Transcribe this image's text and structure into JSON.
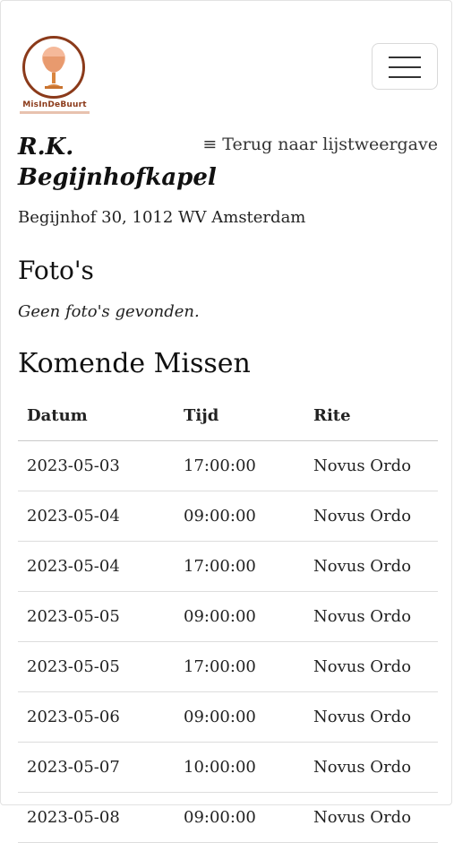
{
  "brand": {
    "logo_text": "MisInDeBuurt",
    "logo_icon": "chalice-icon",
    "accent_color": "#8b3a1a"
  },
  "nav": {
    "menu_icon": "hamburger-icon"
  },
  "church": {
    "name": "R.K. Begijnhofkapel",
    "address": "Begijnhof 30, 1012 WV Amsterdam"
  },
  "back_link": {
    "icon": "≡",
    "label": "Terug naar lijstweergave"
  },
  "photos": {
    "heading": "Foto's",
    "empty_text": "Geen foto's gevonden."
  },
  "masses": {
    "heading": "Komende Missen",
    "columns": [
      "Datum",
      "Tijd",
      "Rite"
    ],
    "rows": [
      [
        "2023-05-03",
        "17:00:00",
        "Novus Ordo"
      ],
      [
        "2023-05-04",
        "09:00:00",
        "Novus Ordo"
      ],
      [
        "2023-05-04",
        "17:00:00",
        "Novus Ordo"
      ],
      [
        "2023-05-05",
        "09:00:00",
        "Novus Ordo"
      ],
      [
        "2023-05-05",
        "17:00:00",
        "Novus Ordo"
      ],
      [
        "2023-05-06",
        "09:00:00",
        "Novus Ordo"
      ],
      [
        "2023-05-07",
        "10:00:00",
        "Novus Ordo"
      ],
      [
        "2023-05-08",
        "09:00:00",
        "Novus Ordo"
      ]
    ]
  }
}
